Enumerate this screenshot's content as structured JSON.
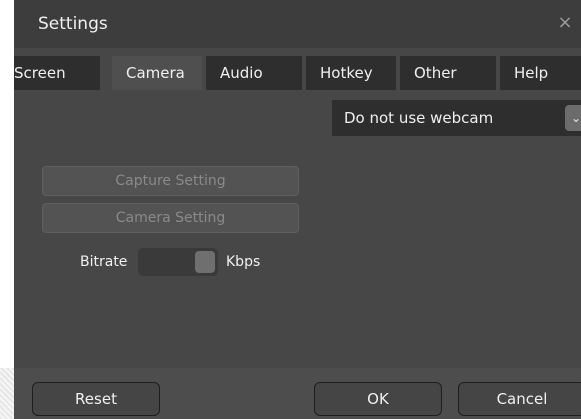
{
  "window": {
    "title": "Settings",
    "close_glyph": "×"
  },
  "tabs": [
    {
      "label": "Screen",
      "active": false
    },
    {
      "label": "Camera",
      "active": true
    },
    {
      "label": "Audio",
      "active": false
    },
    {
      "label": "Hotkey",
      "active": false
    },
    {
      "label": "Other",
      "active": false
    },
    {
      "label": "Help",
      "active": false
    }
  ],
  "camera": {
    "webcam_select_value": "Do not use webcam",
    "dropdown_glyph": "⌄",
    "capture_setting_label": "Capture Setting",
    "camera_setting_label": "Camera Setting",
    "bitrate_label": "Bitrate",
    "bitrate_unit": "Kbps"
  },
  "footer": {
    "reset_label": "Reset",
    "ok_label": "OK",
    "cancel_label": "Cancel"
  },
  "icons": {
    "close": "close-icon",
    "dropdown": "chevron-down-icon"
  },
  "colors": {
    "dialog_bg": "#474747",
    "titlebar_bg": "#3d3d3d",
    "tab_bg": "#2e2e2e",
    "tab_active_bg": "#4f4f4f",
    "footer_bg": "#4d4d4d",
    "text": "#f0f0f0",
    "disabled_text": "#8a8a8a"
  }
}
